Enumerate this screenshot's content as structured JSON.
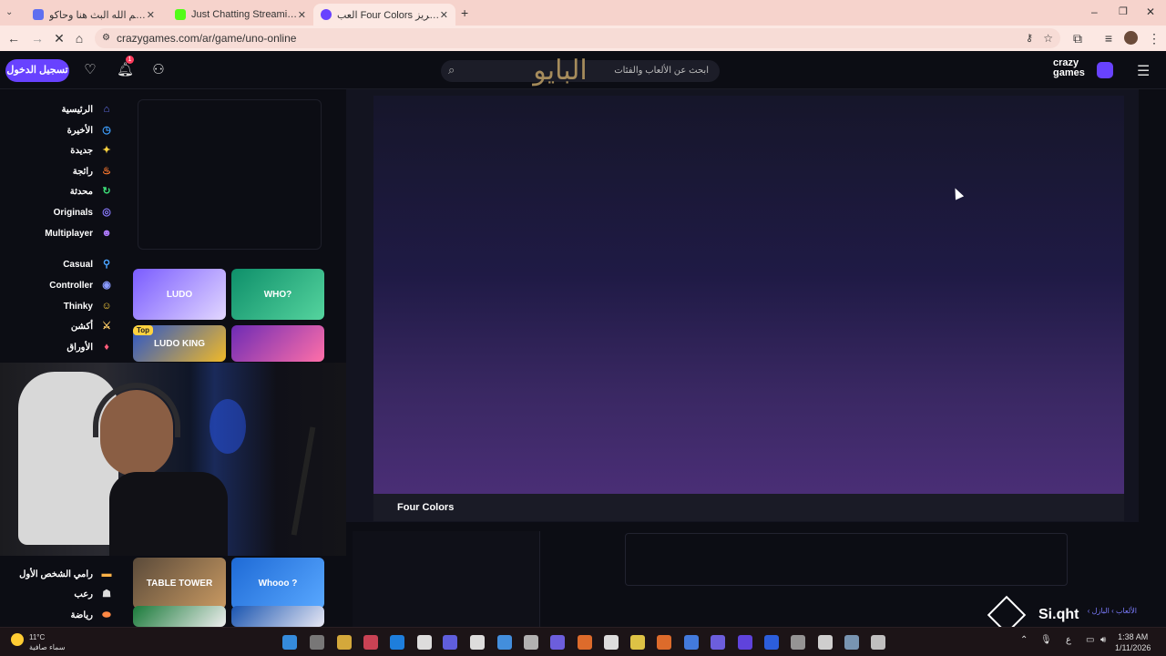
{
  "browser": {
    "tabs": [
      {
        "title": "حياكم الله البث هنا وحاكو (TWRX)",
        "active": false,
        "favicon_color": "#5f6ff0"
      },
      {
        "title": "Just Chatting Streaming - Live",
        "active": false,
        "favicon_color": "#53fc18"
      },
      {
        "title": "العب Four Colors على كريز",
        "active": true,
        "favicon_color": "#6842ff"
      }
    ],
    "new_tab_icon": "plus-icon",
    "url": "crazygames.com/ar/game/uno-online"
  },
  "header": {
    "login_label": "تسجيل الدخول",
    "notification_count": "1",
    "search_placeholder": "ابحث عن الألعاب والفئات",
    "logo_line1": "crazy",
    "logo_line2": "games",
    "watermark_text": "البايو",
    "accent": "#6842ff"
  },
  "sidebar": {
    "items": [
      {
        "label": "الرئيسية",
        "icon": "home-icon",
        "glyph": "⌂",
        "color": "#6b7bff"
      },
      {
        "label": "الأخيرة",
        "icon": "clock-icon",
        "glyph": "◷",
        "color": "#3ea0ff"
      },
      {
        "label": "جديدة",
        "icon": "sparkle-icon",
        "glyph": "✦",
        "color": "#ffd23f"
      },
      {
        "label": "رائجة",
        "icon": "flame-icon",
        "glyph": "♨",
        "color": "#ff7a2f"
      },
      {
        "label": "محدثة",
        "icon": "refresh-icon",
        "glyph": "↻",
        "color": "#3ee07a"
      },
      {
        "label": "Originals",
        "icon": "originals-icon",
        "glyph": "◎",
        "color": "#8a7bff"
      },
      {
        "label": "Multiplayer",
        "icon": "multiplayer-icon",
        "glyph": "☻",
        "color": "#b07bff"
      },
      {
        "label": "Casual",
        "icon": "joystick-icon",
        "glyph": "⚲",
        "color": "#4aa3ff"
      },
      {
        "label": "Controller",
        "icon": "gamepad-icon",
        "glyph": "◉",
        "color": "#8a9bff"
      },
      {
        "label": "Thinky",
        "icon": "brain-icon",
        "glyph": "☺",
        "color": "#ffd23f"
      },
      {
        "label": "أكشن",
        "icon": "sword-icon",
        "glyph": "⚔",
        "color": "#ffcc66"
      },
      {
        "label": "الأوراق",
        "icon": "cards-icon",
        "glyph": "♦",
        "color": "#ff5c7a"
      },
      {
        "label": "رامي الشخص الأول",
        "icon": "gun-icon",
        "glyph": "▬",
        "color": "#ffb347"
      },
      {
        "label": "رعب",
        "icon": "ghost-icon",
        "glyph": "☗",
        "color": "#dddddd"
      },
      {
        "label": "رياضة",
        "icon": "football-icon",
        "glyph": "⬬",
        "color": "#ff8844"
      }
    ]
  },
  "thumbnails": [
    {
      "label": "LUDO",
      "color_a": "#7a5cff",
      "color_b": "#e2d7ff"
    },
    {
      "label": "WHO?",
      "color_a": "#0e8f6a",
      "color_b": "#55d49e"
    },
    {
      "label": "LUDO KING",
      "color_a": "#2a55c9",
      "color_b": "#f0b928",
      "tag": "Top"
    },
    {
      "label": "",
      "color_a": "#6d2bb5",
      "color_b": "#ff6fa8"
    },
    {
      "label": "TABLE TOWER",
      "color_a": "#5a4a3a",
      "color_b": "#c99a62"
    },
    {
      "label": "Whooo ?",
      "color_a": "#1e6ad6",
      "color_b": "#59a8ff"
    },
    {
      "label": "",
      "color_a": "#1a7a3a",
      "color_b": "#eeeeee"
    },
    {
      "label": "",
      "color_a": "#1a55b0",
      "color_b": "#e8e8f4"
    }
  ],
  "game": {
    "title": "Four Colors"
  },
  "breadcrumb": "الألعاب › البازل ›",
  "overlay_brand": "Si.qht",
  "taskbar": {
    "temperature": "11°C",
    "weather": "سماء صافية",
    "time": "1:38 AM",
    "date": "1/11/2026",
    "lang": "ع"
  }
}
